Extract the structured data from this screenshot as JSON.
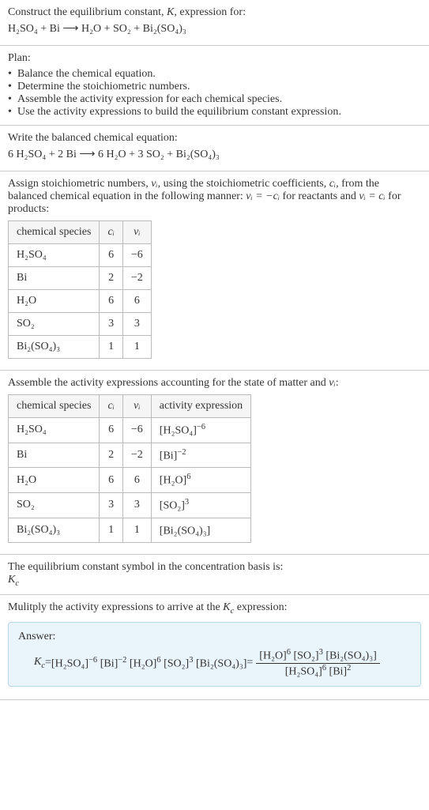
{
  "intro": {
    "line1": "Construct the equilibrium constant, ",
    "k": "K",
    "line1b": ", expression for:",
    "equation_lhs": "H₂SO₄ + Bi",
    "arrow": " ⟶ ",
    "equation_rhs": "H₂O + SO₂ + Bi₂(SO₄)₃"
  },
  "plan": {
    "header": "Plan:",
    "items": [
      "Balance the chemical equation.",
      "Determine the stoichiometric numbers.",
      "Assemble the activity expression for each chemical species.",
      "Use the activity expressions to build the equilibrium constant expression."
    ]
  },
  "balanced": {
    "header": "Write the balanced chemical equation:",
    "lhs": "6 H₂SO₄ + 2 Bi",
    "arrow": " ⟶ ",
    "rhs": "6 H₂O + 3 SO₂ + Bi₂(SO₄)₃"
  },
  "stoich": {
    "intro_a": "Assign stoichiometric numbers, ",
    "nu": "νᵢ",
    "intro_b": ", using the stoichiometric coefficients, ",
    "ci": "cᵢ",
    "intro_c": ", from the balanced chemical equation in the following manner: ",
    "rel1": "νᵢ = −cᵢ",
    "intro_d": " for reactants and ",
    "rel2": "νᵢ = cᵢ",
    "intro_e": " for products:",
    "headers": [
      "chemical species",
      "cᵢ",
      "νᵢ"
    ],
    "rows": [
      [
        "H₂SO₄",
        "6",
        "−6"
      ],
      [
        "Bi",
        "2",
        "−2"
      ],
      [
        "H₂O",
        "6",
        "6"
      ],
      [
        "SO₂",
        "3",
        "3"
      ],
      [
        "Bi₂(SO₄)₃",
        "1",
        "1"
      ]
    ]
  },
  "activity": {
    "intro_a": "Assemble the activity expressions accounting for the state of matter and ",
    "nu": "νᵢ",
    "intro_b": ":",
    "headers": [
      "chemical species",
      "cᵢ",
      "νᵢ",
      "activity expression"
    ],
    "rows": [
      {
        "sp": "H₂SO₄",
        "c": "6",
        "v": "−6",
        "base": "[H₂SO₄]",
        "exp": "−6"
      },
      {
        "sp": "Bi",
        "c": "2",
        "v": "−2",
        "base": "[Bi]",
        "exp": "−2"
      },
      {
        "sp": "H₂O",
        "c": "6",
        "v": "6",
        "base": "[H₂O]",
        "exp": "6"
      },
      {
        "sp": "SO₂",
        "c": "3",
        "v": "3",
        "base": "[SO₂]",
        "exp": "3"
      },
      {
        "sp": "Bi₂(SO₄)₃",
        "c": "1",
        "v": "1",
        "base": "[Bi₂(SO₄)₃]",
        "exp": ""
      }
    ]
  },
  "symbol": {
    "line": "The equilibrium constant symbol in the concentration basis is:",
    "kc": "K",
    "kc_sub": "c"
  },
  "multiply": {
    "line_a": "Mulitply the activity expressions to arrive at the ",
    "kc": "K",
    "kc_sub": "c",
    "line_b": " expression:"
  },
  "answer": {
    "label": "Answer:",
    "kc": "K",
    "kc_sub": "c",
    "eq": " = ",
    "flat": [
      {
        "b": "[H₂SO₄]",
        "e": "−6"
      },
      {
        "b": " [Bi]",
        "e": "−2"
      },
      {
        "b": " [H₂O]",
        "e": "6"
      },
      {
        "b": " [SO₂]",
        "e": "3"
      },
      {
        "b": " [Bi₂(SO₄)₃]",
        "e": ""
      }
    ],
    "eq2": " = ",
    "num": [
      {
        "b": "[H₂O]",
        "e": "6"
      },
      {
        "b": " [SO₂]",
        "e": "3"
      },
      {
        "b": " [Bi₂(SO₄)₃]",
        "e": ""
      }
    ],
    "den": [
      {
        "b": "[H₂SO₄]",
        "e": "6"
      },
      {
        "b": " [Bi]",
        "e": "2"
      }
    ]
  },
  "chart_data": {
    "type": "table",
    "tables": [
      {
        "title": "stoichiometric numbers",
        "columns": [
          "chemical species",
          "cᵢ",
          "νᵢ"
        ],
        "rows": [
          [
            "H₂SO₄",
            6,
            -6
          ],
          [
            "Bi",
            2,
            -2
          ],
          [
            "H₂O",
            6,
            6
          ],
          [
            "SO₂",
            3,
            3
          ],
          [
            "Bi₂(SO₄)₃",
            1,
            1
          ]
        ]
      },
      {
        "title": "activity expressions",
        "columns": [
          "chemical species",
          "cᵢ",
          "νᵢ",
          "activity expression"
        ],
        "rows": [
          [
            "H₂SO₄",
            6,
            -6,
            "[H₂SO₄]^−6"
          ],
          [
            "Bi",
            2,
            -2,
            "[Bi]^−2"
          ],
          [
            "H₂O",
            6,
            6,
            "[H₂O]^6"
          ],
          [
            "SO₂",
            3,
            3,
            "[SO₂]^3"
          ],
          [
            "Bi₂(SO₄)₃",
            1,
            1,
            "[Bi₂(SO₄)₃]"
          ]
        ]
      }
    ]
  }
}
